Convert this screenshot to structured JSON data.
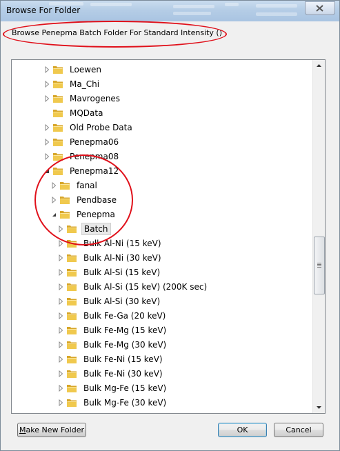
{
  "window": {
    "title": "Browse For Folder"
  },
  "description": "Browse Penepma Batch Folder For Standard Intensity ()",
  "tree": {
    "rows": [
      {
        "label": "Loewen",
        "level": 1,
        "expander": "collapsed"
      },
      {
        "label": "Ma_Chi",
        "level": 1,
        "expander": "collapsed"
      },
      {
        "label": "Mavrogenes",
        "level": 1,
        "expander": "collapsed"
      },
      {
        "label": "MQData",
        "level": 1,
        "expander": "none"
      },
      {
        "label": "Old Probe Data",
        "level": 1,
        "expander": "collapsed"
      },
      {
        "label": "Penepma06",
        "level": 1,
        "expander": "collapsed"
      },
      {
        "label": "Penepma08",
        "level": 1,
        "expander": "collapsed"
      },
      {
        "label": "Penepma12",
        "level": 1,
        "expander": "expanded"
      },
      {
        "label": "fanal",
        "level": 2,
        "expander": "collapsed"
      },
      {
        "label": "Pendbase",
        "level": 2,
        "expander": "collapsed"
      },
      {
        "label": "Penepma",
        "level": 2,
        "expander": "expanded"
      },
      {
        "label": "Batch",
        "level": 3,
        "expander": "collapsed",
        "selected": true
      },
      {
        "label": "Bulk Al-Ni (15 keV)",
        "level": 3,
        "expander": "collapsed"
      },
      {
        "label": "Bulk Al-Ni (30 keV)",
        "level": 3,
        "expander": "collapsed"
      },
      {
        "label": "Bulk Al-Si (15 keV)",
        "level": 3,
        "expander": "collapsed"
      },
      {
        "label": "Bulk Al-Si (15 keV) (200K sec)",
        "level": 3,
        "expander": "collapsed"
      },
      {
        "label": "Bulk Al-Si (30 keV)",
        "level": 3,
        "expander": "collapsed"
      },
      {
        "label": "Bulk Fe-Ga (20 keV)",
        "level": 3,
        "expander": "collapsed"
      },
      {
        "label": "Bulk Fe-Mg (15 keV)",
        "level": 3,
        "expander": "collapsed"
      },
      {
        "label": "Bulk Fe-Mg (30 keV)",
        "level": 3,
        "expander": "collapsed"
      },
      {
        "label": "Bulk Fe-Ni (15 keV)",
        "level": 3,
        "expander": "collapsed"
      },
      {
        "label": "Bulk Fe-Ni (30 keV)",
        "level": 3,
        "expander": "collapsed"
      },
      {
        "label": "Bulk Mg-Fe (15 keV)",
        "level": 3,
        "expander": "collapsed"
      },
      {
        "label": "Bulk Mg-Fe (30 keV)",
        "level": 3,
        "expander": "collapsed"
      }
    ]
  },
  "buttons": {
    "make_new_folder_prefix": "M",
    "make_new_folder_rest": "ake New Folder",
    "ok": "OK",
    "cancel": "Cancel"
  },
  "icons": {
    "folder": "folder-icon",
    "close": "close-icon",
    "expander_collapsed": "triangle-right-icon",
    "expander_expanded": "triangle-down-icon"
  },
  "colors": {
    "annotation": "#e0101a",
    "folder_fill": "#f0c94e",
    "folder_dark": "#d7a629"
  }
}
